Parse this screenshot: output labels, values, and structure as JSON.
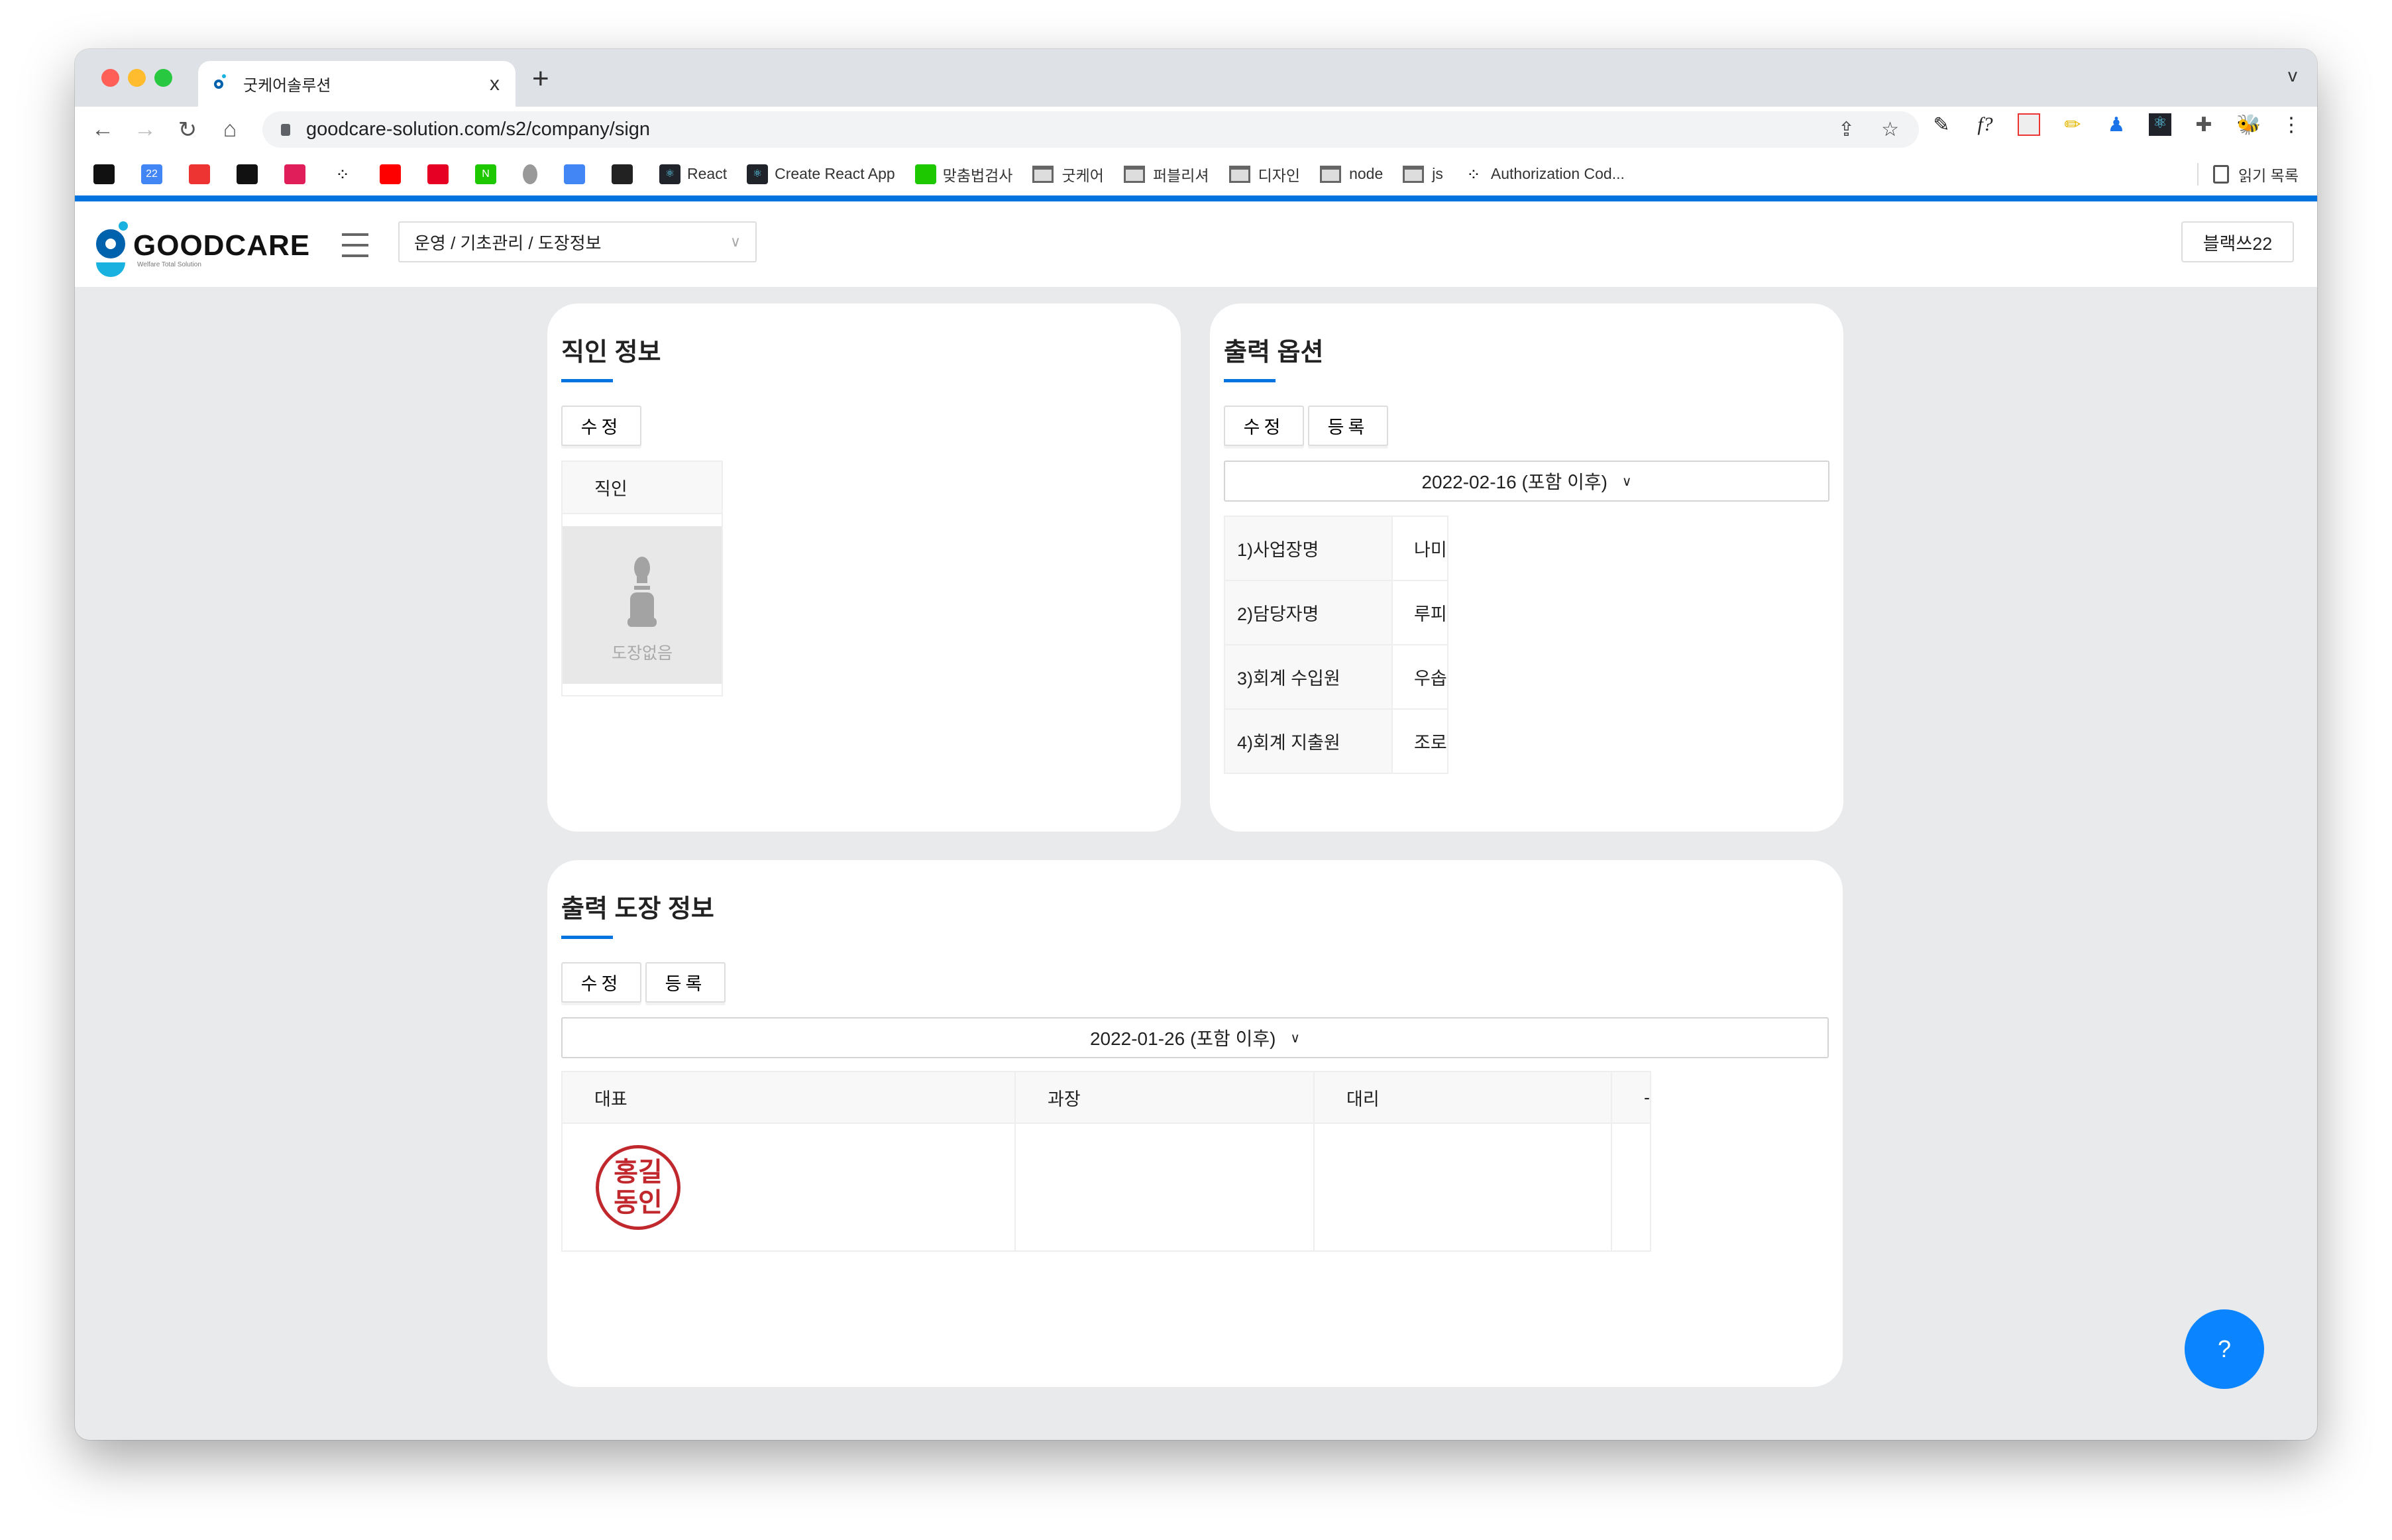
{
  "browser": {
    "tab_title": "굿케어솔루션",
    "tab_close": "x",
    "new_tab": "+",
    "tab_menu": "v",
    "url": "goodcare-solution.com/s2/company/sign",
    "extensions_text": "f?",
    "bookmarks": [
      {
        "icon": "app-icon",
        "label": ""
      },
      {
        "icon": "calendar-icon",
        "label": "22"
      },
      {
        "icon": "diamond-icon",
        "label": ""
      },
      {
        "icon": "app-icon",
        "label": ""
      },
      {
        "icon": "slack-icon",
        "label": ""
      },
      {
        "icon": "dots-icon",
        "label": ""
      },
      {
        "icon": "youtube-icon",
        "label": ""
      },
      {
        "icon": "pinterest-icon",
        "label": ""
      },
      {
        "icon": "naver-icon",
        "label": "N"
      },
      {
        "icon": "apple-icon",
        "label": ""
      },
      {
        "icon": "translate-icon",
        "label": ""
      },
      {
        "icon": "github-icon",
        "label": ""
      },
      {
        "icon": "react-icon",
        "label": "React"
      },
      {
        "icon": "react-icon",
        "label": "Create React App"
      },
      {
        "icon": "naver-icon",
        "label": "맞춤법검사"
      },
      {
        "icon": "folder-icon",
        "label": "굿케어"
      },
      {
        "icon": "folder-icon",
        "label": "퍼블리셔"
      },
      {
        "icon": "folder-icon",
        "label": "디자인"
      },
      {
        "icon": "folder-icon",
        "label": "node"
      },
      {
        "icon": "folder-icon",
        "label": "js"
      },
      {
        "icon": "dots-icon",
        "label": "Authorization Cod..."
      }
    ],
    "reading_list": "읽기 목록"
  },
  "header": {
    "logo_text": "GOODCARE",
    "logo_sub": "Welfare Total Solution",
    "breadcrumb": "운영 / 기초관리 / 도장정보",
    "user": "블랙쓰22"
  },
  "seal_info": {
    "title": "직인 정보",
    "edit": "수정",
    "column": "직인",
    "placeholder": "도장없음"
  },
  "print_options": {
    "title": "출력 옵션",
    "edit": "수정",
    "register": "등록",
    "date_select": "2022-02-16 (포함 이후)",
    "rows": [
      {
        "label": "1)사업장명",
        "value": "나미"
      },
      {
        "label": "2)담당자명",
        "value": "루피"
      },
      {
        "label": "3)회계 수입원",
        "value": "우솝"
      },
      {
        "label": "4)회계 지출원",
        "value": "조로"
      }
    ]
  },
  "print_stamp": {
    "title": "출력 도장 정보",
    "edit": "수정",
    "register": "등록",
    "date_select": "2022-01-26 (포함 이후)",
    "columns": [
      "대표",
      "과장",
      "대리",
      "-"
    ],
    "stamp_text": "홍길동인"
  },
  "help_label": "?",
  "colors": {
    "accent": "#0073de",
    "help": "#0a84ff",
    "stamp": "#c0282d",
    "page_bg": "#e9eaec"
  }
}
